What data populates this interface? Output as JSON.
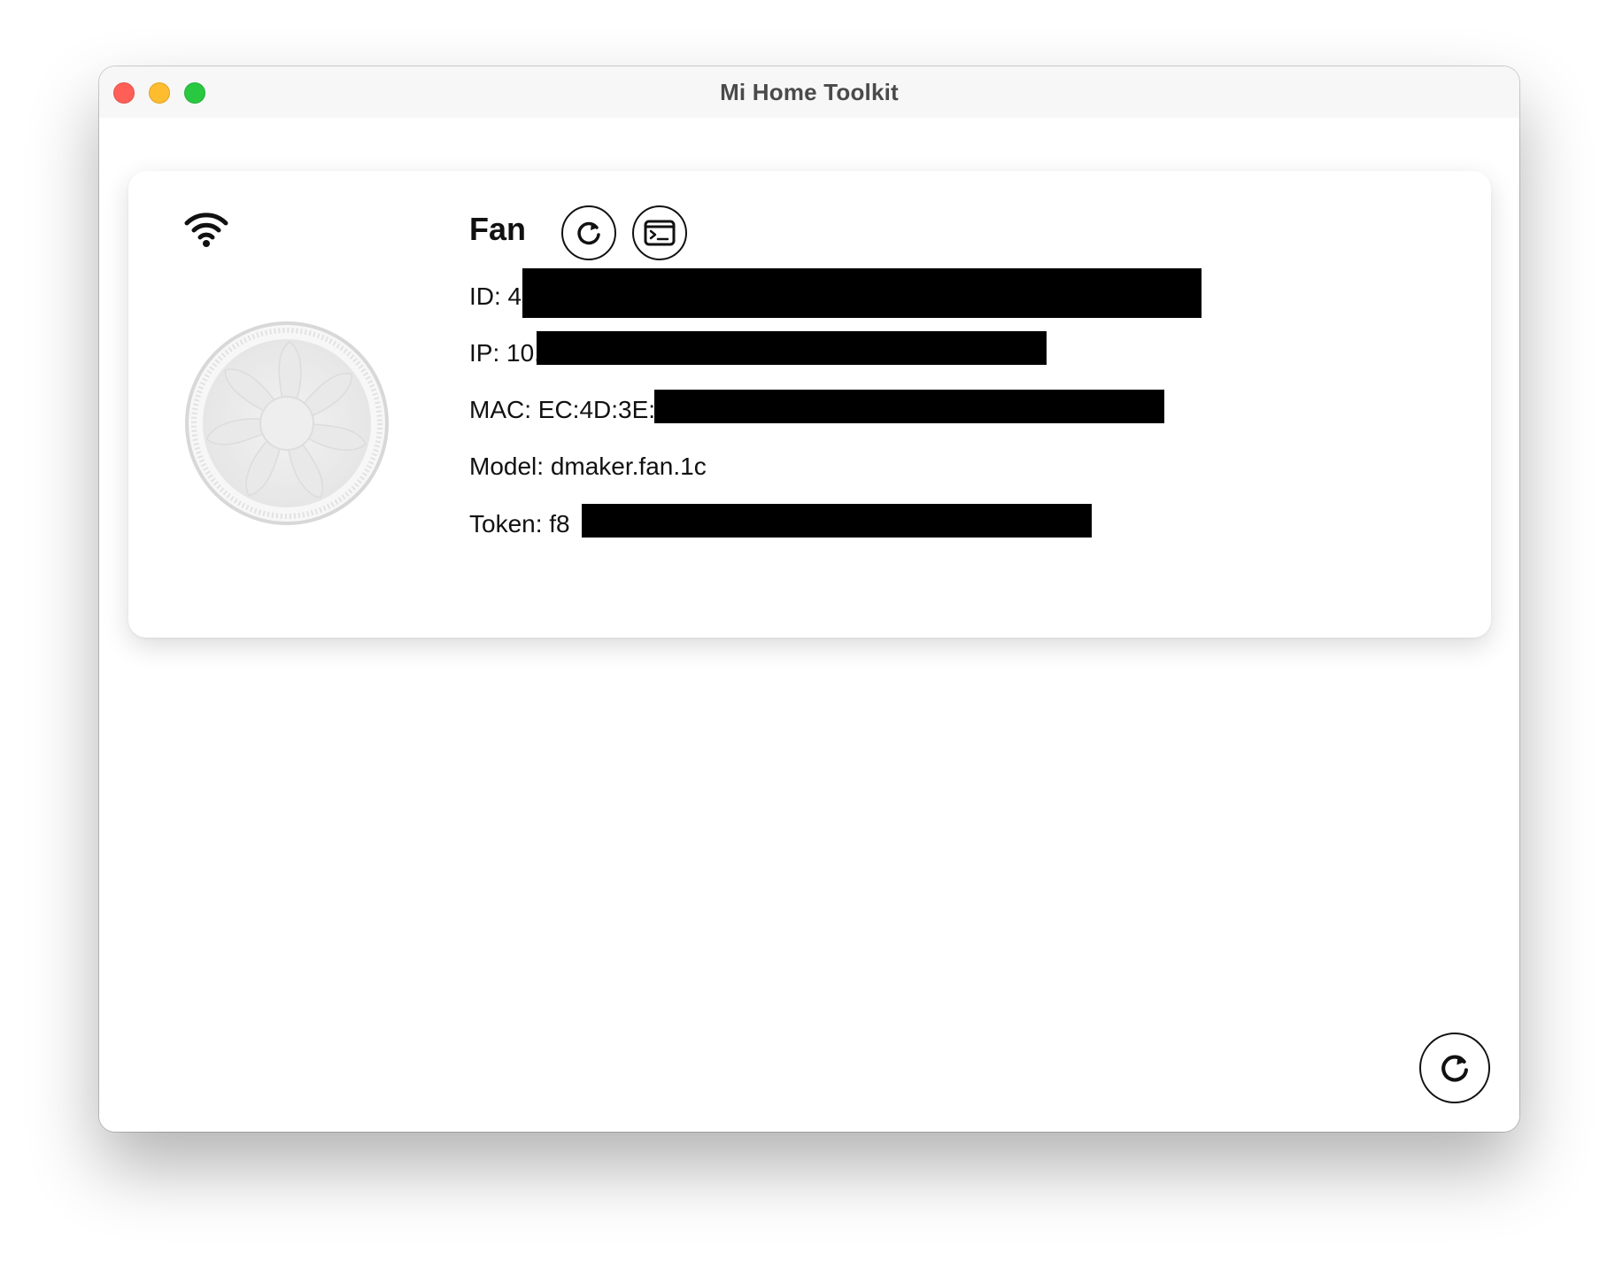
{
  "window": {
    "title": "Mi Home Toolkit"
  },
  "device": {
    "name": "Fan",
    "id_label": "ID: 4",
    "ip_label": "IP: 10.",
    "mac_label": "MAC: EC:4D:3E:",
    "model_label": "Model: dmaker.fan.1c",
    "token_label": "Token: f8",
    "icons": {
      "connection": "wifi-icon",
      "refresh": "refresh-icon",
      "console": "terminal-icon",
      "image": "fan-image"
    }
  },
  "footer": {
    "refresh_icon": "refresh-icon"
  },
  "colors": {
    "close": "#ff5f57",
    "minimize": "#febc2e",
    "maximize": "#28c840",
    "redaction": "#000000"
  }
}
